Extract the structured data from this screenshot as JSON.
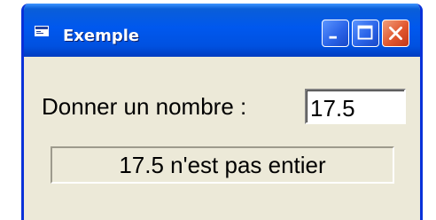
{
  "window": {
    "title": "Exemple",
    "icons": {
      "app": "form-icon",
      "minimize": "minimize-icon",
      "maximize": "maximize-icon",
      "close": "close-icon"
    }
  },
  "form": {
    "prompt_label": "Donner un nombre :",
    "number_value": "17.5",
    "result_text": "17.5 n'est pas entier"
  },
  "colors": {
    "titlebar": "#0058ee",
    "frame": "#0831d9",
    "client": "#ece9d8",
    "close_button": "#e1572e"
  }
}
